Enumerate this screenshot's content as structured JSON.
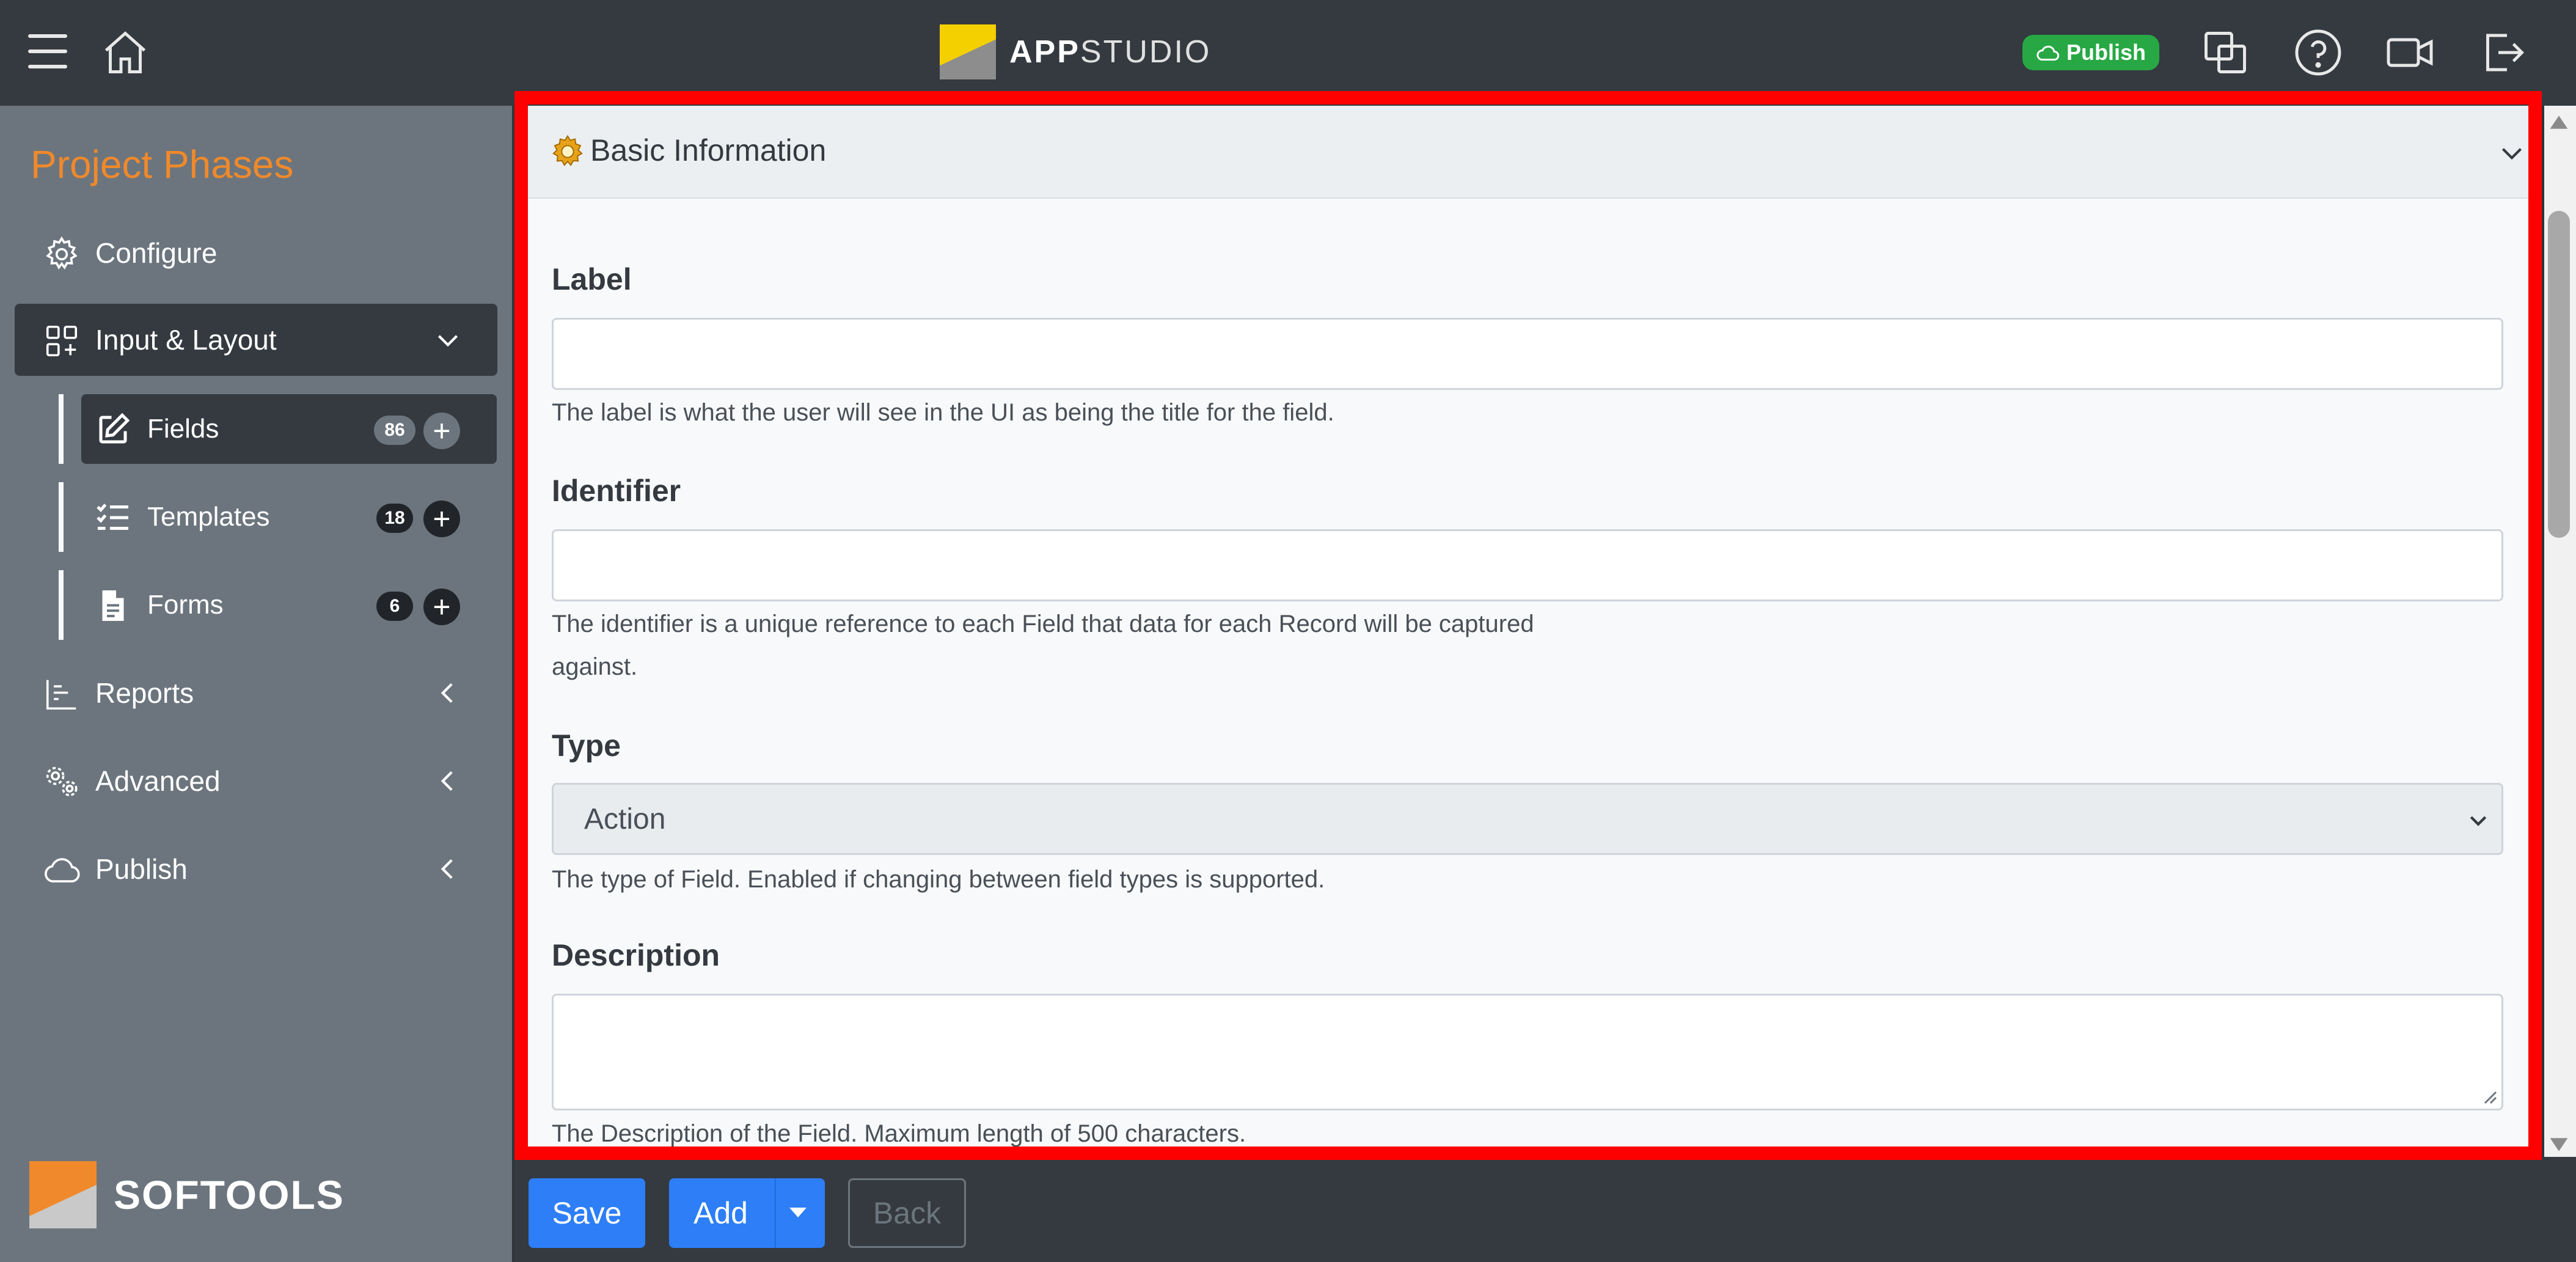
{
  "header": {
    "app_name_bold": "APP",
    "app_name_rest": "STUDIO",
    "publish_badge": "Publish"
  },
  "sidebar": {
    "title": "Project Phases",
    "items": [
      {
        "label": "Configure"
      },
      {
        "label": "Input & Layout"
      },
      {
        "label": "Reports"
      },
      {
        "label": "Advanced"
      },
      {
        "label": "Publish"
      }
    ],
    "subitems": [
      {
        "label": "Fields",
        "count": "86"
      },
      {
        "label": "Templates",
        "count": "18"
      },
      {
        "label": "Forms",
        "count": "6"
      }
    ],
    "brand": "SOFTOOLS"
  },
  "card": {
    "title": "Basic Information"
  },
  "form": {
    "label": {
      "title": "Label",
      "value": "",
      "help": "The label is what the user will see in the UI as being the title for the field."
    },
    "identifier": {
      "title": "Identifier",
      "value": "",
      "help_line1": "The identifier is a unique reference to each Field that data for each Record will be captured",
      "help_line2": "against."
    },
    "type": {
      "title": "Type",
      "selected": "Action",
      "help": "The type of Field. Enabled if changing between field types is supported."
    },
    "description": {
      "title": "Description",
      "value": "",
      "help": "The Description of the Field. Maximum length of 500 characters."
    }
  },
  "footer": {
    "save": "Save",
    "add": "Add",
    "back": "Back"
  },
  "colors": {
    "accent": "#f0892b",
    "primary": "#2d7ef7",
    "success": "#27a844",
    "highlight": "#ff0000"
  }
}
